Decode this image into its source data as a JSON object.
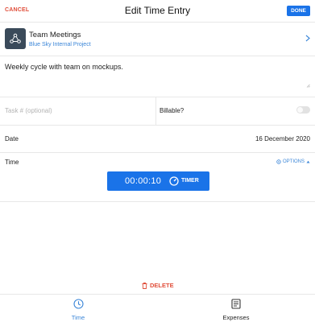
{
  "header": {
    "cancel_label": "CANCEL",
    "title": "Edit Time Entry",
    "done_label": "DONE"
  },
  "project": {
    "name": "Team Meetings",
    "client": "Blue Sky Internal Project",
    "icon": "team-icon"
  },
  "notes": {
    "value": "Weekly cycle with team on mockups."
  },
  "task": {
    "placeholder": "Task # (optional)",
    "value": ""
  },
  "billable": {
    "label": "Billable?",
    "on": false
  },
  "date": {
    "label": "Date",
    "value": "16 December 2020"
  },
  "time": {
    "label": "Time",
    "options_label": "OPTIONS",
    "timer_value": "00:00:10",
    "timer_label": "TIMER"
  },
  "delete_label": "DELETE",
  "tabs": [
    {
      "label": "Time",
      "icon": "clock-icon",
      "active": true
    },
    {
      "label": "Expenses",
      "icon": "receipt-icon",
      "active": false
    }
  ],
  "colors": {
    "accent": "#1a73e8",
    "link": "#3b86d8",
    "danger": "#e04e3a",
    "project_icon_bg": "#3a4a5a"
  }
}
